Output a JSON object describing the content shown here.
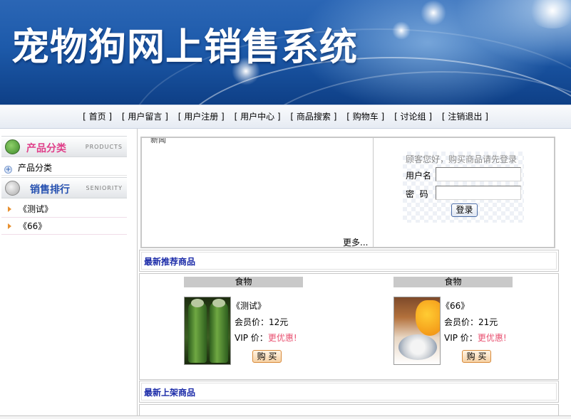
{
  "banner": {
    "title": "宠物狗网上销售系统"
  },
  "nav": {
    "items": [
      "[ 首页 ]",
      "[ 用户留言 ]",
      "[ 用户注册 ]",
      "[ 用户中心 ]",
      "[ 商品搜索 ]",
      "[ 购物车 ]",
      "[ 讨论组 ]",
      "[ 注销退出 ]"
    ]
  },
  "sidebar": {
    "category_header": {
      "title": "产品分类",
      "subtitle": "PRODUCTS"
    },
    "category_items": [
      "产品分类"
    ],
    "ranking_header": {
      "title": "销售排行",
      "subtitle": "SENIORITY"
    },
    "ranking_items": [
      "《测试》",
      "《66》"
    ]
  },
  "news": {
    "label": "新闻",
    "more": "更多..."
  },
  "login": {
    "greeting": "顾客您好，购买商品请先登录",
    "username_label": "用户名",
    "password_label": "密  码",
    "username_value": "",
    "password_value": "",
    "submit_label": "登录"
  },
  "recommended": {
    "title": "最新推荐商品",
    "products": [
      {
        "type": "食物",
        "name": "《测试》",
        "member_price": "会员价：12元",
        "vip_label": "VIP 价：",
        "vip_value": "更优惠!",
        "buy_label": "购 买"
      },
      {
        "type": "食物",
        "name": "《66》",
        "member_price": "会员价：21元",
        "vip_label": "VIP 价：",
        "vip_value": "更优惠!",
        "buy_label": "购 买"
      }
    ]
  },
  "new_arrivals": {
    "title": "最新上架商品"
  }
}
